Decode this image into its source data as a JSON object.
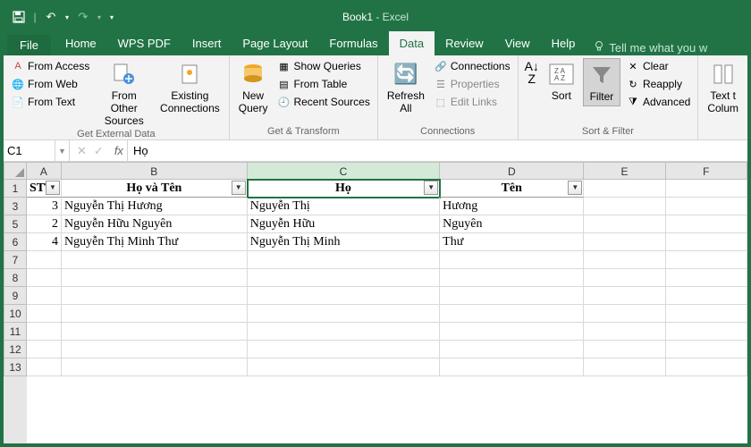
{
  "app": {
    "doc": "Book1",
    "suffix": " - Excel"
  },
  "qat": {
    "save": "save-icon",
    "undo": "undo-icon",
    "redo": "redo-icon"
  },
  "tabs": {
    "file": "File",
    "items": [
      "Home",
      "WPS PDF",
      "Insert",
      "Page Layout",
      "Formulas",
      "Data",
      "Review",
      "View",
      "Help"
    ],
    "active": "Data",
    "tellme": "Tell me what you w"
  },
  "ribbon": {
    "group_external": {
      "label": "Get External Data",
      "from_access": "From Access",
      "from_web": "From Web",
      "from_text": "From Text",
      "from_other": "From Other\nSources",
      "existing": "Existing\nConnections"
    },
    "group_transform": {
      "label": "Get & Transform",
      "new_query": "New\nQuery",
      "show_queries": "Show Queries",
      "from_table": "From Table",
      "recent": "Recent Sources"
    },
    "group_conn": {
      "label": "Connections",
      "refresh": "Refresh\nAll",
      "connections": "Connections",
      "properties": "Properties",
      "edit_links": "Edit Links"
    },
    "group_sort": {
      "label": "Sort & Filter",
      "sort": "Sort",
      "filter": "Filter",
      "clear": "Clear",
      "reapply": "Reapply",
      "advanced": "Advanced"
    },
    "group_tools": {
      "text_cols": "Text t\nColum"
    }
  },
  "formula_bar": {
    "ref": "C1",
    "fx": "fx",
    "value": "Họ"
  },
  "grid": {
    "cols": [
      "A",
      "B",
      "C",
      "D",
      "E",
      "F"
    ],
    "selected_col": "C",
    "row_headers": [
      "1",
      "3",
      "5",
      "6",
      "7",
      "8",
      "9",
      "10",
      "11",
      "12",
      "13"
    ],
    "header_row": {
      "A": "STT",
      "B": "Họ và Tên",
      "C": "Họ",
      "D": "Tên"
    },
    "filter_cols": [
      "A",
      "B",
      "C",
      "D"
    ],
    "rows": [
      {
        "A": "3",
        "B": "Nguyễn Thị Hương",
        "C": "Nguyễn Thị",
        "D": "Hương"
      },
      {
        "A": "2",
        "B": "Nguyễn Hữu Nguyên",
        "C": "Nguyễn Hữu",
        "D": "Nguyên"
      },
      {
        "A": "4",
        "B": "Nguyễn Thị Minh Thư",
        "C": "Nguyễn Thị Minh",
        "D": "Thư"
      }
    ]
  }
}
